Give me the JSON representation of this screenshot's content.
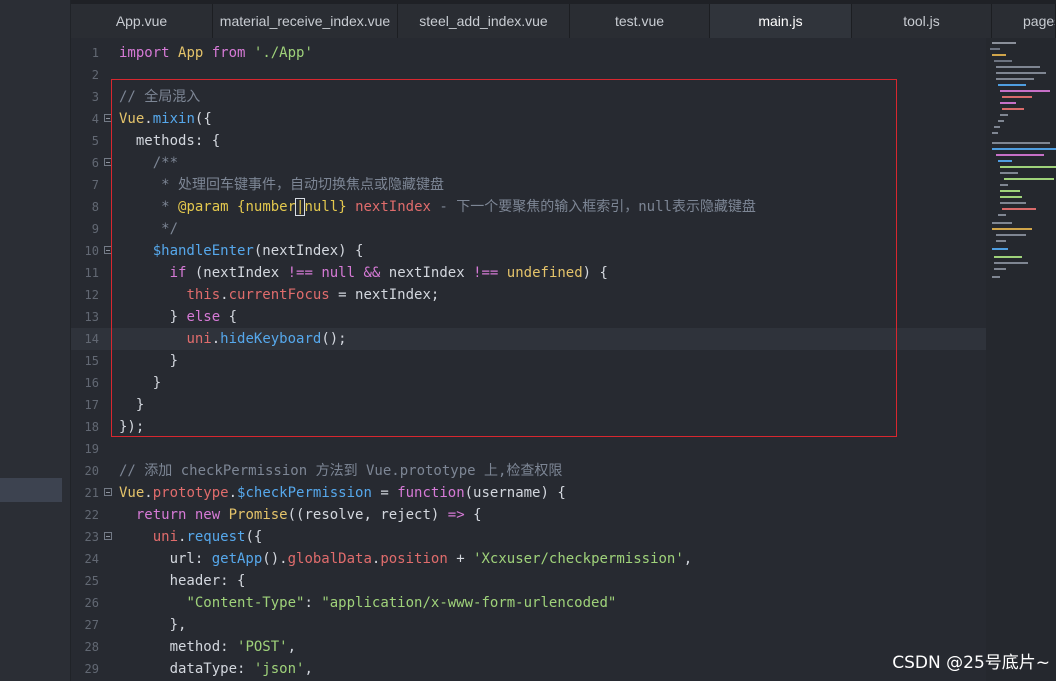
{
  "tabs": [
    "App.vue",
    "material_receive_index.vue",
    "steel_add_index.vue",
    "test.vue",
    "main.js",
    "tool.js",
    "pages"
  ],
  "active_tab": "main.js",
  "watermark": "CSDN @25号底片~",
  "lines": [
    {
      "n": "1",
      "segs": [
        [
          "k",
          "import "
        ],
        [
          "kw",
          "App "
        ],
        [
          "k",
          "from "
        ],
        [
          "str",
          "'./App'"
        ]
      ]
    },
    {
      "n": "2",
      "segs": []
    },
    {
      "n": "3",
      "segs": [
        [
          "cm",
          "// 全局混入"
        ]
      ]
    },
    {
      "n": "4",
      "fold": true,
      "segs": [
        [
          "kw",
          "Vue"
        ],
        [
          "p",
          "."
        ],
        [
          "fn",
          "mixin"
        ],
        [
          "p",
          "({"
        ]
      ]
    },
    {
      "n": "5",
      "segs": [
        [
          "p",
          "  methods: {"
        ]
      ]
    },
    {
      "n": "6",
      "fold": true,
      "segs": [
        [
          "cm",
          "    /**"
        ]
      ]
    },
    {
      "n": "7",
      "segs": [
        [
          "cm",
          "     * 处理回车键事件，自动切换焦点或隐藏键盘"
        ]
      ]
    },
    {
      "n": "8",
      "segs": [
        [
          "cm",
          "     * "
        ],
        [
          "tag",
          "@param"
        ],
        [
          "cm",
          " "
        ],
        [
          "tag",
          "{number"
        ],
        [
          "tagc",
          "|"
        ],
        [
          "tag",
          "null}"
        ],
        [
          "cm",
          " "
        ],
        [
          "vr",
          "nextIndex"
        ],
        [
          "cm",
          " - 下一个要聚焦的输入框索引，null表示隐藏键盘"
        ]
      ]
    },
    {
      "n": "9",
      "segs": [
        [
          "cm",
          "     */"
        ]
      ]
    },
    {
      "n": "10",
      "fold": true,
      "segs": [
        [
          "p",
          "    "
        ],
        [
          "fn",
          "$handleEnter"
        ],
        [
          "p",
          "(nextIndex) {"
        ]
      ]
    },
    {
      "n": "11",
      "segs": [
        [
          "p",
          "      "
        ],
        [
          "k",
          "if"
        ],
        [
          "p",
          " (nextIndex "
        ],
        [
          "k",
          "!=="
        ],
        [
          "p",
          " "
        ],
        [
          "k",
          "null"
        ],
        [
          "p",
          " "
        ],
        [
          "k",
          "&&"
        ],
        [
          "p",
          " nextIndex "
        ],
        [
          "k",
          "!=="
        ],
        [
          "p",
          " "
        ],
        [
          "kw",
          "undefined"
        ],
        [
          "p",
          ") {"
        ]
      ]
    },
    {
      "n": "12",
      "segs": [
        [
          "p",
          "        "
        ],
        [
          "vr",
          "this"
        ],
        [
          "p",
          "."
        ],
        [
          "vr",
          "currentFocus"
        ],
        [
          "p",
          " = nextIndex;"
        ]
      ]
    },
    {
      "n": "13",
      "segs": [
        [
          "p",
          "      } "
        ],
        [
          "k",
          "else"
        ],
        [
          "p",
          " {"
        ]
      ]
    },
    {
      "n": "14",
      "cur": true,
      "segs": [
        [
          "p",
          "        "
        ],
        [
          "vr",
          "uni"
        ],
        [
          "p",
          "."
        ],
        [
          "fn",
          "hideKeyboard"
        ],
        [
          "p",
          "();"
        ]
      ]
    },
    {
      "n": "15",
      "segs": [
        [
          "p",
          "      }"
        ]
      ]
    },
    {
      "n": "16",
      "segs": [
        [
          "p",
          "    }"
        ]
      ]
    },
    {
      "n": "17",
      "segs": [
        [
          "p",
          "  }"
        ]
      ]
    },
    {
      "n": "18",
      "segs": [
        [
          "p",
          "});"
        ]
      ]
    },
    {
      "n": "19",
      "segs": []
    },
    {
      "n": "20",
      "segs": [
        [
          "cm",
          "// 添加 checkPermission 方法到 Vue.prototype 上,检查权限"
        ]
      ]
    },
    {
      "n": "21",
      "fold": true,
      "segs": [
        [
          "kw",
          "Vue"
        ],
        [
          "p",
          "."
        ],
        [
          "vr",
          "prototype"
        ],
        [
          "p",
          "."
        ],
        [
          "fn",
          "$checkPermission"
        ],
        [
          "p",
          " = "
        ],
        [
          "k",
          "function"
        ],
        [
          "p",
          "(username) {"
        ]
      ]
    },
    {
      "n": "22",
      "segs": [
        [
          "p",
          "  "
        ],
        [
          "k",
          "return"
        ],
        [
          "p",
          " "
        ],
        [
          "k",
          "new"
        ],
        [
          "p",
          " "
        ],
        [
          "kw",
          "Promise"
        ],
        [
          "p",
          "((resolve, reject) "
        ],
        [
          "k",
          "=>"
        ],
        [
          "p",
          " {"
        ]
      ]
    },
    {
      "n": "23",
      "fold": true,
      "segs": [
        [
          "p",
          "    "
        ],
        [
          "vr",
          "uni"
        ],
        [
          "p",
          "."
        ],
        [
          "fn",
          "request"
        ],
        [
          "p",
          "({"
        ]
      ]
    },
    {
      "n": "24",
      "segs": [
        [
          "p",
          "      url: "
        ],
        [
          "fn",
          "getApp"
        ],
        [
          "p",
          "()."
        ],
        [
          "vr",
          "globalData"
        ],
        [
          "p",
          "."
        ],
        [
          "vr",
          "position"
        ],
        [
          "p",
          " + "
        ],
        [
          "str",
          "'Xcxuser/checkpermission'"
        ],
        [
          "p",
          ","
        ]
      ]
    },
    {
      "n": "25",
      "segs": [
        [
          "p",
          "      header: {"
        ]
      ]
    },
    {
      "n": "26",
      "segs": [
        [
          "p",
          "        "
        ],
        [
          "str",
          "\"Content-Type\""
        ],
        [
          "p",
          ": "
        ],
        [
          "str",
          "\"application/x-www-form-urlencoded\""
        ]
      ]
    },
    {
      "n": "27",
      "segs": [
        [
          "p",
          "      },"
        ]
      ]
    },
    {
      "n": "28",
      "segs": [
        [
          "p",
          "      method: "
        ],
        [
          "str",
          "'POST'"
        ],
        [
          "p",
          ","
        ]
      ]
    },
    {
      "n": "29",
      "segs": [
        [
          "p",
          "      dataType: "
        ],
        [
          "str",
          "'json'"
        ],
        [
          "p",
          ","
        ]
      ]
    }
  ]
}
